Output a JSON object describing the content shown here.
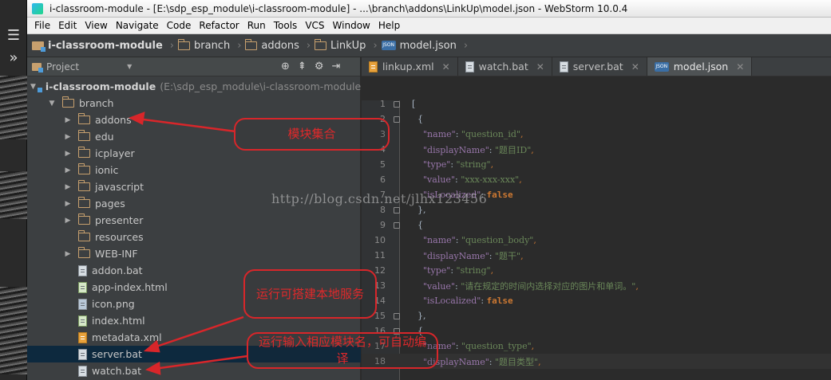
{
  "window_title": "i-classroom-module - [E:\\sdp_esp_module\\i-classroom-module] - ...\\branch\\addons\\LinkUp\\model.json - WebStorm 10.0.4",
  "menu": [
    "File",
    "Edit",
    "View",
    "Navigate",
    "Code",
    "Refactor",
    "Run",
    "Tools",
    "VCS",
    "Window",
    "Help"
  ],
  "breadcrumbs": [
    "i-classroom-module",
    "branch",
    "addons",
    "LinkUp",
    "model.json"
  ],
  "project_panel": {
    "title": "Project",
    "tree": [
      {
        "label": "i-classroom-module",
        "path": "(E:\\sdp_esp_module\\i-classroom-module)",
        "icon": "module-folder-icon",
        "expanded": true
      },
      {
        "label": "branch",
        "icon": "folder-icon",
        "expanded": true
      },
      {
        "label": "addons",
        "icon": "folder-icon",
        "expanded": false
      },
      {
        "label": "edu",
        "icon": "folder-icon",
        "expanded": false
      },
      {
        "label": "icplayer",
        "icon": "folder-icon",
        "expanded": false
      },
      {
        "label": "ionic",
        "icon": "folder-icon",
        "expanded": false
      },
      {
        "label": "javascript",
        "icon": "folder-icon",
        "expanded": false
      },
      {
        "label": "pages",
        "icon": "folder-icon",
        "expanded": false
      },
      {
        "label": "presenter",
        "icon": "folder-icon",
        "expanded": false
      },
      {
        "label": "resources",
        "icon": "folder-icon"
      },
      {
        "label": "WEB-INF",
        "icon": "folder-icon",
        "expanded": false
      },
      {
        "label": "addon.bat",
        "icon": "bat-file-icon"
      },
      {
        "label": "app-index.html",
        "icon": "html-file-icon"
      },
      {
        "label": "icon.png",
        "icon": "image-file-icon"
      },
      {
        "label": "index.html",
        "icon": "html-file-icon"
      },
      {
        "label": "metadata.xml",
        "icon": "xml-file-icon"
      },
      {
        "label": "server.bat",
        "icon": "bat-file-icon",
        "selected": true
      },
      {
        "label": "watch.bat",
        "icon": "bat-file-icon"
      }
    ]
  },
  "tabs": [
    {
      "label": "linkup.xml",
      "icon": "xml-file-icon",
      "active": false
    },
    {
      "label": "watch.bat",
      "icon": "bat-file-icon",
      "active": false
    },
    {
      "label": "server.bat",
      "icon": "bat-file-icon",
      "active": false
    },
    {
      "label": "model.json",
      "icon": "json-file-icon",
      "active": true
    }
  ],
  "code_lines": [
    {
      "n": "1",
      "text": "["
    },
    {
      "n": "2",
      "text": "  {"
    },
    {
      "n": "3",
      "key": "\"name\"",
      "value": "\"question_id\"",
      "end": ","
    },
    {
      "n": "4",
      "key": "\"displayName\"",
      "value": "\"题目ID\"",
      "end": ","
    },
    {
      "n": "5",
      "key": "\"type\"",
      "value": "\"string\"",
      "end": ","
    },
    {
      "n": "6",
      "key": "\"value\"",
      "value": "\"xxx-xxx-xxx\"",
      "end": ","
    },
    {
      "n": "7",
      "key": "\"isLocalized\"",
      "bool": "false"
    },
    {
      "n": "8",
      "text": "  },"
    },
    {
      "n": "9",
      "text": "  {"
    },
    {
      "n": "10",
      "key": "\"name\"",
      "value": "\"question_body\"",
      "end": ","
    },
    {
      "n": "11",
      "key": "\"displayName\"",
      "value": "\"题干\"",
      "end": ","
    },
    {
      "n": "12",
      "key": "\"type\"",
      "value": "\"string\"",
      "end": ","
    },
    {
      "n": "13",
      "key": "\"value\"",
      "value": "\"请在规定的时间内选择对应的图片和单词。\"",
      "end": ","
    },
    {
      "n": "14",
      "key": "\"isLocalized\"",
      "bool": "false"
    },
    {
      "n": "15",
      "text": "  },"
    },
    {
      "n": "16",
      "text": "  {"
    },
    {
      "n": "17",
      "key": "\"name\"",
      "value": "\"question_type\"",
      "end": ","
    },
    {
      "n": "18",
      "key": "\"displayName\"",
      "value": "\"题目类型\"",
      "end": ","
    }
  ],
  "watermark": "http://blog.csdn.net/jlhx123456",
  "annotations": [
    {
      "text": "模块集合"
    },
    {
      "text": "运行可搭建本地服务"
    },
    {
      "text": "运行输入相应模块名，可自动编译"
    }
  ],
  "colors": {
    "callout": "#d8262a",
    "selection": "#0d293e",
    "editor_bg": "#2b2b2b",
    "panel_bg": "#3c3f41"
  }
}
